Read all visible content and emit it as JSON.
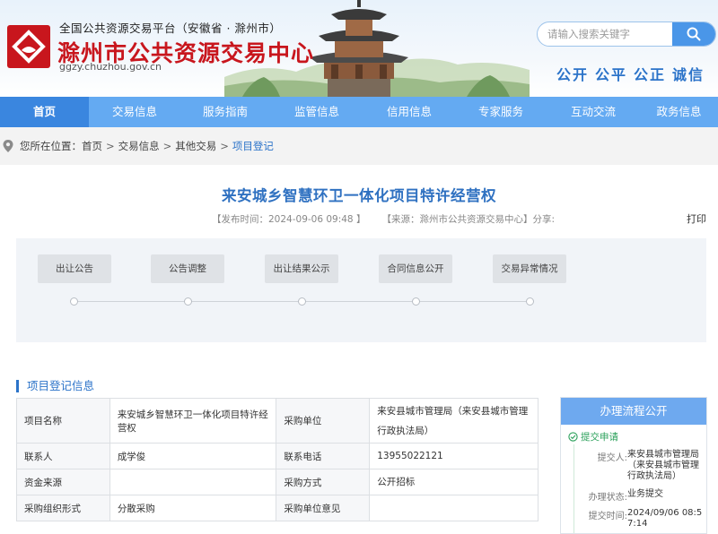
{
  "header": {
    "platform_line": "全国公共资源交易平台（安徽省 · 滁州市）",
    "site_name": "滁州市公共资源交易中心",
    "url": "ggzy.chuzhou.gov.cn",
    "search_placeholder": "请输入搜索关键字",
    "slogan": [
      "公开",
      "公平",
      "公正",
      "诚信"
    ],
    "logo_color": "#c8161d"
  },
  "nav": {
    "items": [
      "首页",
      "交易信息",
      "服务指南",
      "监管信息",
      "信用信息",
      "专家服务",
      "互动交流",
      "政务信息"
    ],
    "active_index": 0,
    "bar_color": "#64aaf2",
    "active_color": "#3a86df"
  },
  "breadcrumb": {
    "prefix": "您所在位置：",
    "items": [
      "首页",
      "交易信息",
      "其他交易",
      "项目登记"
    ],
    "separator": ">"
  },
  "article": {
    "title": "来安城乡智慧环卫一体化项目特许经营权",
    "publish_time": "【发布时间：2024-09-06 09:48 】",
    "source": "【来源：滁州市公共资源交易中心】分享:",
    "print_label": "打印"
  },
  "process": {
    "steps": [
      "出让公告",
      "公告调整",
      "出让结果公示",
      "合同信息公开",
      "交易异常情况"
    ]
  },
  "project_info": {
    "section_title": "项目登记信息",
    "rows": [
      {
        "k1": "项目名称",
        "v1": "来安城乡智慧环卫一体化项目特许经营权",
        "k2": "采购单位",
        "v2": "来安县城市管理局（来安县城市管理行政执法局）"
      },
      {
        "k1": "联系人",
        "v1": "成学俊",
        "k2": "联系电话",
        "v2": "13955022121"
      },
      {
        "k1": "资金来源",
        "v1": "",
        "k2": "采购方式",
        "v2": "公开招标"
      },
      {
        "k1": "采购组织形式",
        "v1": "分散采购",
        "k2": "采购单位意见",
        "v2": ""
      }
    ]
  },
  "flow_card": {
    "title": "办理流程公开",
    "step_label": "提交申请",
    "submitter_key": "提交人:",
    "submitter_val": "来安县城市管理局（来安县城市管理行政执法局）",
    "status_key": "办理状态:",
    "status_val": "业务提交",
    "time_key": "提交时间:",
    "time_val": "2024/09/06 08:57:14",
    "step_color": "#2aa05a"
  }
}
